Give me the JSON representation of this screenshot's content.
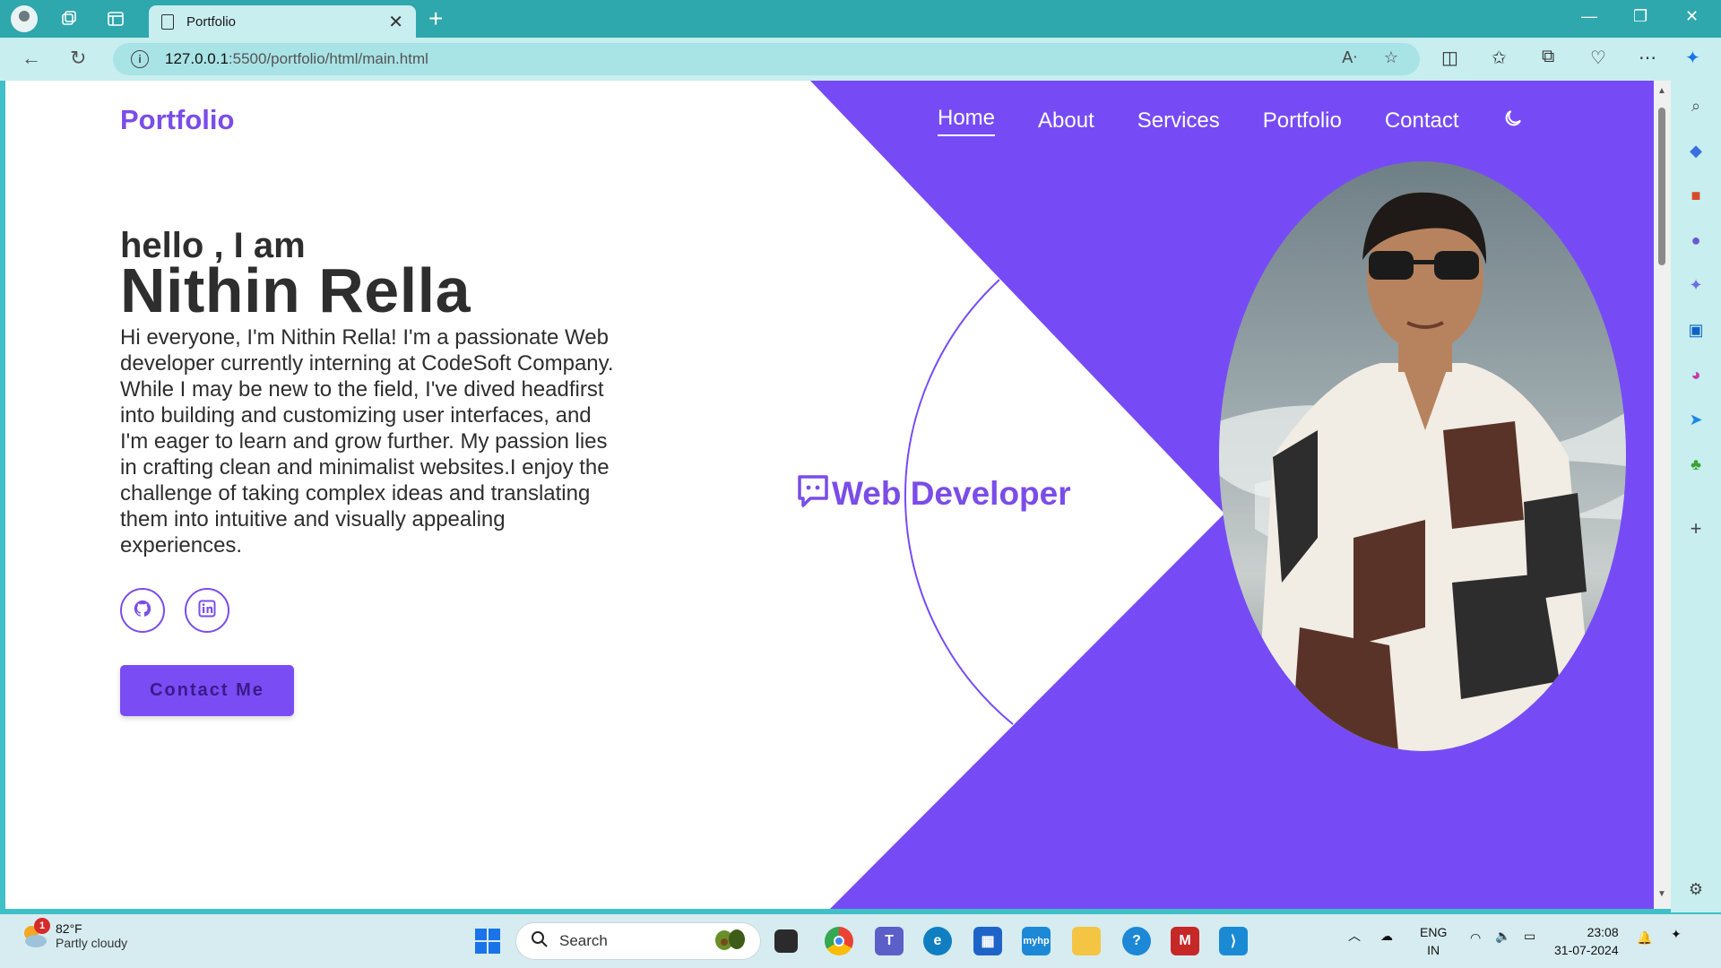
{
  "browser": {
    "tab_title": "Portfolio",
    "url_host": "127.0.0.1",
    "url_rest": ":5500/portfolio/html/main.html"
  },
  "site": {
    "logo": "Portfolio",
    "nav": [
      "Home",
      "About",
      "Services",
      "Portfolio",
      "Contact"
    ],
    "active_nav": "Home",
    "greeting": "hello , I am",
    "name": "Nithin Rella",
    "intro": "Hi everyone, I'm Nithin Rella! I'm a passionate Web developer currently interning at CodeSoft Company. While I may be new to the field, I've dived headfirst into building and customizing user interfaces, and I'm eager to learn and grow further. My passion lies in crafting clean and minimalist websites.I enjoy the challenge of taking complex ideas and translating them into intuitive and visually appealing experiences.",
    "contact_button": "Contact Me",
    "role": "Web Developer",
    "socials": [
      "github-icon",
      "linkedin-icon"
    ]
  },
  "taskbar": {
    "weather_temp": "82°F",
    "weather_cond": "Partly cloudy",
    "weather_badge": "1",
    "search_label": "Search",
    "lang_top": "ENG",
    "lang_bottom": "IN",
    "time": "23:08",
    "date": "31-07-2024"
  },
  "colors": {
    "accent": "#7a4de8",
    "hero_purple": "#764bf6",
    "chrome_teal": "#2ea7ad"
  }
}
